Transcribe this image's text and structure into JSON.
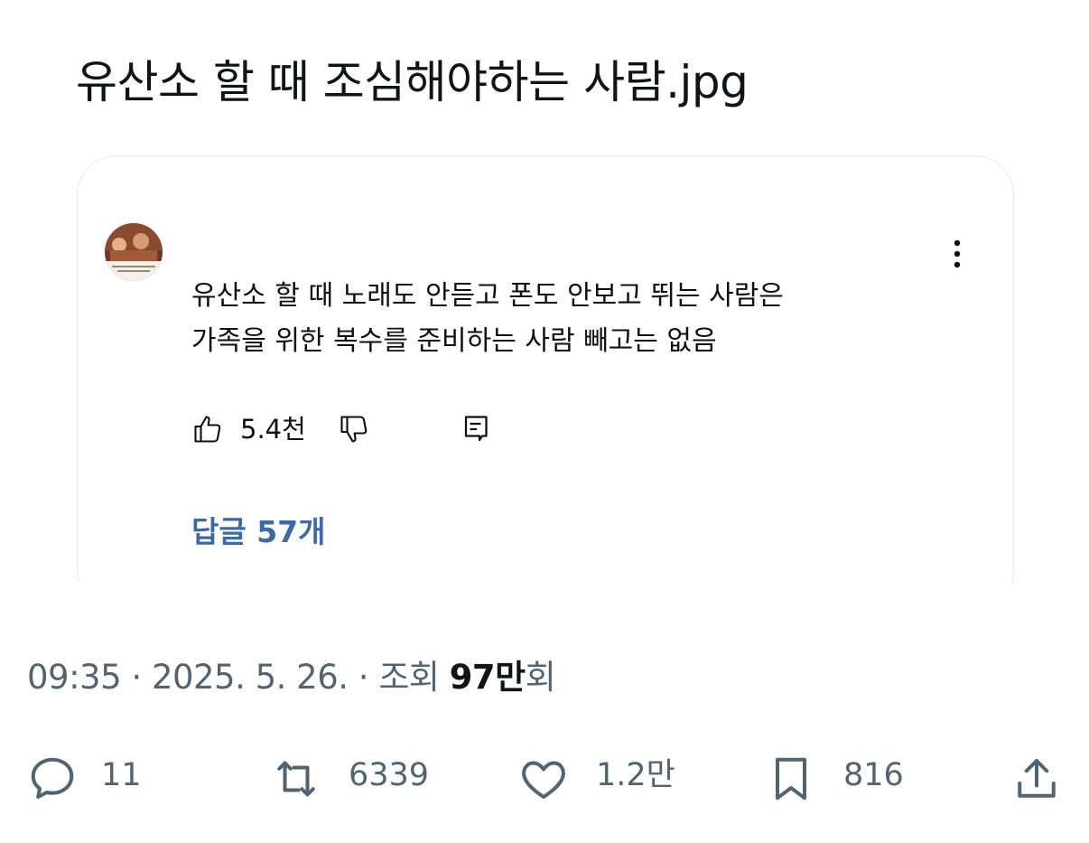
{
  "post": {
    "title": "유산소 할 때 조심해야하는 사람.jpg"
  },
  "embed": {
    "comment_lines": [
      "유산소 할 때 노래도 안듣고 폰도 안보고 뛰는 사람은",
      "가족을 위한 복수를 준비하는 사람 빼고는 없음"
    ],
    "likes": "5.4천",
    "replies_label": "답글 57개",
    "avatar_icon": "profile-avatar-icon",
    "icons": [
      "thumbs-up-icon",
      "thumbs-down-icon",
      "reply-comment-icon",
      "more-vertical-icon"
    ]
  },
  "meta": {
    "time": "09:35",
    "separator": " · ",
    "date": "2025. 5. 26.",
    "views_prefix": "조회 ",
    "views_number": "97만",
    "views_suffix": "회"
  },
  "engagement": {
    "replies": "11",
    "retweets": "6339",
    "likes": "1.2만",
    "bookmarks": "816"
  },
  "colors": {
    "text_primary": "#0f1419",
    "text_secondary": "#536471",
    "link_blue": "#3d6aa6",
    "card_border": "#e6e8eb"
  }
}
